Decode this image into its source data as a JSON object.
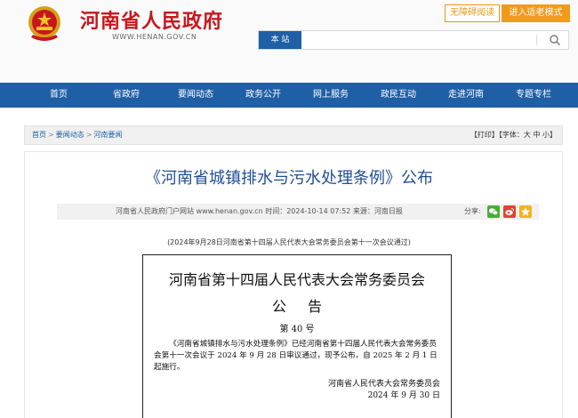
{
  "header": {
    "site_title": "河南省人民政府",
    "site_url": "WWW.HENAN.GOV.CN",
    "accessibility_label": "无障碍阅读",
    "elder_mode_label": "进入适老模式",
    "emblem_icon": "national-emblem-icon",
    "brand_red": "#c8161d",
    "brand_blue": "#1f5fa6"
  },
  "search": {
    "scope": "本 站",
    "value": "",
    "icon": "search-icon"
  },
  "nav": {
    "items": [
      {
        "label": "首页"
      },
      {
        "label": "省政府"
      },
      {
        "label": "要闻动态"
      },
      {
        "label": "政务公开"
      },
      {
        "label": "网上服务"
      },
      {
        "label": "政民互动"
      },
      {
        "label": "走进河南"
      },
      {
        "label": "专题专栏"
      }
    ]
  },
  "breadcrumb": {
    "items": [
      "首页",
      "要闻动态",
      "河南要闻"
    ],
    "separator": ">",
    "tools": "【打印】【字体：大 中 小】"
  },
  "article": {
    "title": "《河南省城镇排水与污水处理条例》公布",
    "meta": "河南省人民政府门户网站 www.henan.gov.cn    时间：2024-10-14 07:52    来源：河南日报",
    "share_label": "分享:",
    "share_icons": [
      "wechat-icon",
      "weibo-icon",
      "qzone-icon"
    ],
    "subtitle": "(2024年9月28日河南省第十四届人民代表大会常务委员会第十一次会议通过)",
    "notice": {
      "heading": "河南省第十四届人民代表大会常务委员会",
      "heading2": "公告",
      "number": "第 40 号",
      "body": "《河南省城镇排水与污水处理条例》已经河南省第十四届人民代表大会常务委员会第十一次会议于 2024 年 9 月 28 日审议通过，现予公布，自 2025 年 2 月 1 日起施行。",
      "signatory": "河南省人民代表大会常务委员会",
      "date": "2024 年 9 月 30 日"
    }
  }
}
